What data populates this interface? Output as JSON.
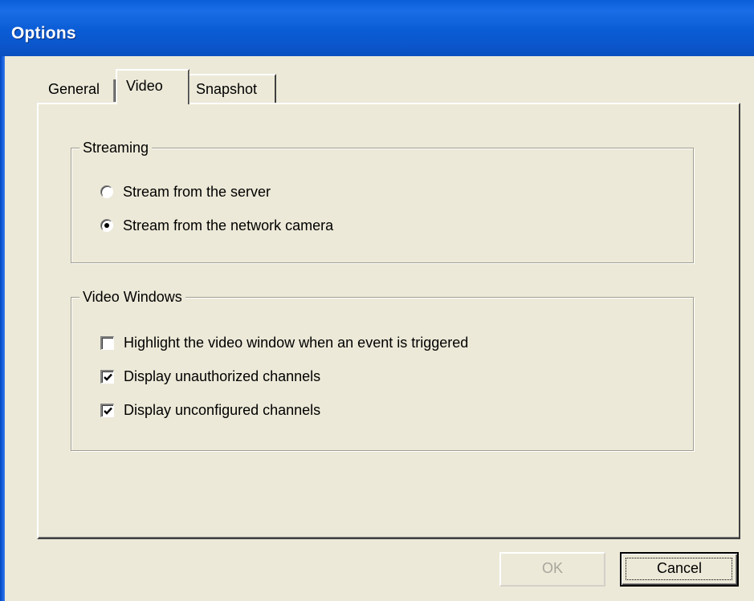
{
  "window": {
    "title": "Options"
  },
  "tabs": [
    {
      "label": "General",
      "selected": false
    },
    {
      "label": "Video",
      "selected": true
    },
    {
      "label": "Snapshot",
      "selected": false
    }
  ],
  "streaming": {
    "title": "Streaming",
    "options": [
      {
        "label": "Stream from the server",
        "selected": false
      },
      {
        "label": "Stream from the network camera",
        "selected": true
      }
    ]
  },
  "video_windows": {
    "title": "Video Windows",
    "options": [
      {
        "label": "Highlight the video window when an event is triggered",
        "checked": false
      },
      {
        "label": "Display unauthorized channels",
        "checked": true
      },
      {
        "label": "Display unconfigured channels",
        "checked": true
      }
    ]
  },
  "buttons": {
    "ok": {
      "label": "OK",
      "enabled": false
    },
    "cancel": {
      "label": "Cancel",
      "enabled": true,
      "focused": true
    }
  },
  "colors": {
    "titlebar": "#0a5cd5",
    "face": "#ece9d8",
    "disabled_text": "#a8a69c"
  }
}
